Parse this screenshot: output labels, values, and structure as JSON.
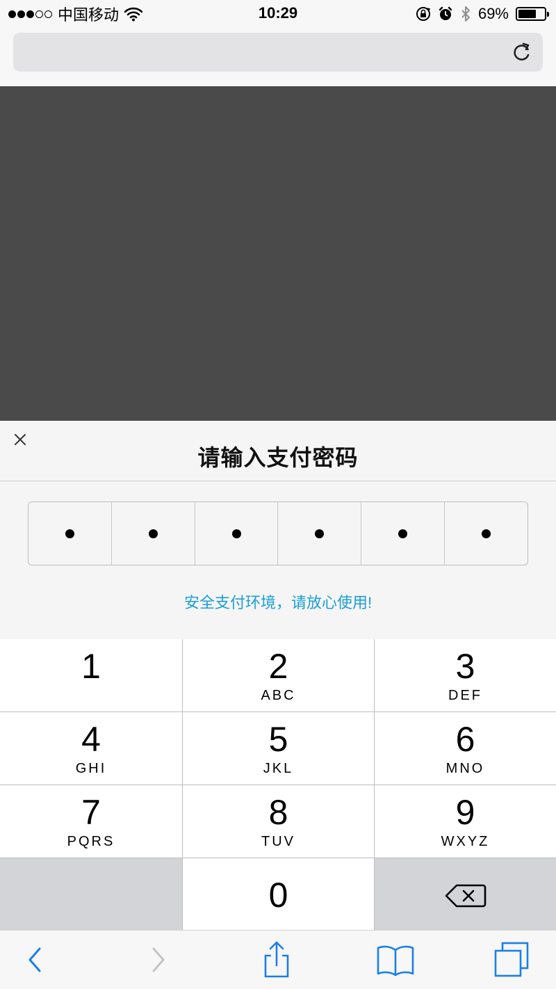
{
  "status_bar": {
    "signal_bars": [
      true,
      true,
      true,
      false,
      false
    ],
    "carrier": "中国移动",
    "time": "10:29",
    "battery_percent": "69%",
    "battery_level": 0.69,
    "icons": [
      "wifi-icon",
      "orientation-lock-icon",
      "alarm-icon",
      "bluetooth-icon",
      "battery-icon"
    ]
  },
  "address_bar": {
    "url": "",
    "reload_icon": "reload-icon"
  },
  "password_sheet": {
    "title": "请输入支付密码",
    "close_icon": "close-icon",
    "pin_length": 6,
    "pin_filled": 6,
    "note": "安全支付环境，请放心使用!"
  },
  "keypad": {
    "keys": [
      {
        "digit": "1",
        "letters": ""
      },
      {
        "digit": "2",
        "letters": "ABC"
      },
      {
        "digit": "3",
        "letters": "DEF"
      },
      {
        "digit": "4",
        "letters": "GHI"
      },
      {
        "digit": "5",
        "letters": "JKL"
      },
      {
        "digit": "6",
        "letters": "MNO"
      },
      {
        "digit": "7",
        "letters": "PQRS"
      },
      {
        "digit": "8",
        "letters": "TUV"
      },
      {
        "digit": "9",
        "letters": "WXYZ"
      },
      {
        "digit": "",
        "letters": ""
      },
      {
        "digit": "0",
        "letters": ""
      },
      {
        "digit": "",
        "letters": "",
        "icon": "backspace-icon"
      }
    ]
  },
  "toolbar": {
    "buttons": [
      "back-icon",
      "forward-icon",
      "share-icon",
      "bookmarks-icon",
      "tabs-icon"
    ],
    "accent_color": "#1a7fe8",
    "disabled_color": "#c4c4c8"
  },
  "colors": {
    "note_color": "#1a9fd6",
    "overlay": "#4a4a4a"
  }
}
